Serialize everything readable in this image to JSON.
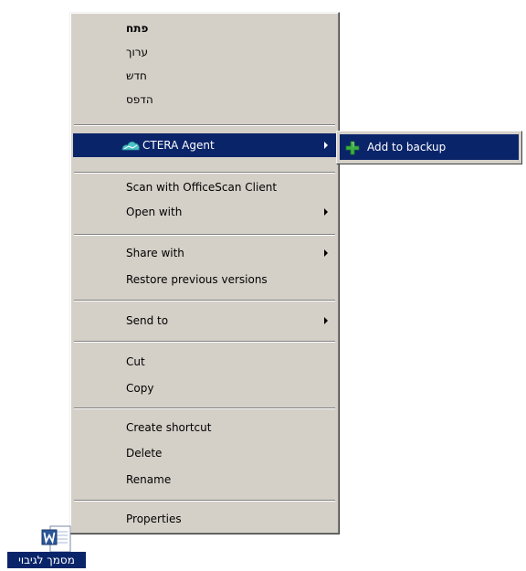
{
  "menu": {
    "items": [
      {
        "label": "פתח"
      },
      {
        "label": "ערוך"
      },
      {
        "label": "חדש"
      },
      {
        "label": "הדפס"
      },
      {
        "label": "CTERA Agent"
      },
      {
        "label": "Scan with OfficeScan Client"
      },
      {
        "label": "Open with"
      },
      {
        "label": "Share with"
      },
      {
        "label": "Restore previous versions"
      },
      {
        "label": "Send to"
      },
      {
        "label": "Cut"
      },
      {
        "label": "Copy"
      },
      {
        "label": "Create shortcut"
      },
      {
        "label": "Delete"
      },
      {
        "label": "Rename"
      },
      {
        "label": "Properties"
      }
    ]
  },
  "submenu": {
    "items": [
      {
        "label": "Add to backup",
        "icon": "plus-icon"
      }
    ]
  },
  "desktop": {
    "file_label": "מסמך לגיבוי",
    "file_icon": "word-document-icon"
  },
  "colors": {
    "menu_bg": "#d4d0c8",
    "highlight": "#0a246a",
    "plus_green": "#3cb043",
    "ctera_icon": "#4cc3c9"
  }
}
